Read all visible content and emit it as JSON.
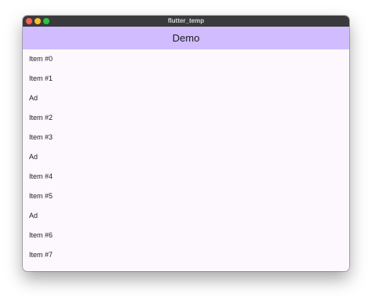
{
  "window": {
    "title": "flutter_temp",
    "traffic_lights": {
      "close": "#fe5f57",
      "minimize": "#febc2e",
      "zoom": "#28c840"
    }
  },
  "appbar": {
    "title": "Demo",
    "color": "#d0bcff"
  },
  "list": {
    "items": [
      {
        "label": "Item #0"
      },
      {
        "label": "Item #1"
      },
      {
        "label": "Ad"
      },
      {
        "label": "Item #2"
      },
      {
        "label": "Item #3"
      },
      {
        "label": "Ad"
      },
      {
        "label": "Item #4"
      },
      {
        "label": "Item #5"
      },
      {
        "label": "Ad"
      },
      {
        "label": "Item #6"
      },
      {
        "label": "Item #7"
      }
    ]
  }
}
